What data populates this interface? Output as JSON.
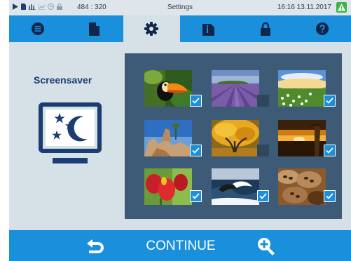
{
  "status_bar": {
    "coordinates": "484 : 320",
    "title": "Settings",
    "time": "16:16",
    "date": "13.11.2017",
    "icons": [
      "play-icon",
      "document-icon",
      "steam-icon",
      "chart-icon",
      "clock-icon",
      "lock-icon"
    ],
    "warning_icon": "warning-icon"
  },
  "tabs": [
    {
      "icon": "menu-list-icon",
      "active": false
    },
    {
      "icon": "document-icon",
      "active": false
    },
    {
      "icon": "gear-icon",
      "active": true
    },
    {
      "icon": "info-document-icon",
      "active": false
    },
    {
      "icon": "lock-icon",
      "active": false
    },
    {
      "icon": "help-icon",
      "active": false
    }
  ],
  "panel": {
    "title": "Screensaver",
    "icon": "screensaver-monitor-icon"
  },
  "gallery": {
    "images": [
      {
        "subject": "toucan",
        "selected": true
      },
      {
        "subject": "lavender-field",
        "selected": false
      },
      {
        "subject": "flower-meadow",
        "selected": true
      },
      {
        "subject": "desert-rocks",
        "selected": true
      },
      {
        "subject": "autumn-tree",
        "selected": false
      },
      {
        "subject": "sunset",
        "selected": true
      },
      {
        "subject": "red-tulips",
        "selected": true
      },
      {
        "subject": "ocean-wave",
        "selected": true
      },
      {
        "subject": "coffee-beans",
        "selected": true
      }
    ]
  },
  "bottom_bar": {
    "back_icon": "back-arrow-icon",
    "continue_label": "CONTINUE",
    "zoom_icon": "zoom-in-icon"
  },
  "colors": {
    "accent": "#1a8fdc",
    "background": "#d6e0e7",
    "gallery_bg": "#3d5b76",
    "title_text": "#1a3d72"
  }
}
